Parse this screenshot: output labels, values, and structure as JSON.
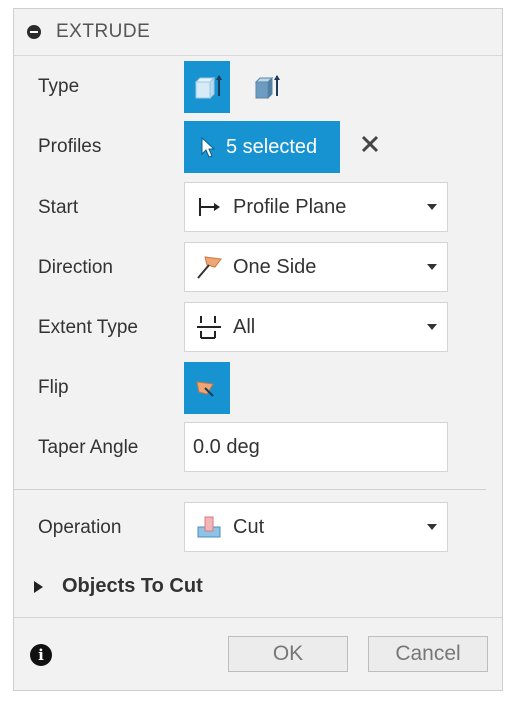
{
  "header": {
    "title": "EXTRUDE"
  },
  "rows": {
    "type": {
      "label": "Type"
    },
    "profiles": {
      "label": "Profiles",
      "selection": "5 selected"
    },
    "start": {
      "label": "Start",
      "value": "Profile Plane"
    },
    "direction": {
      "label": "Direction",
      "value": "One Side"
    },
    "extent_type": {
      "label": "Extent Type",
      "value": "All"
    },
    "flip": {
      "label": "Flip"
    },
    "taper_angle": {
      "label": "Taper Angle",
      "value": "0.0 deg"
    },
    "operation": {
      "label": "Operation",
      "value": "Cut"
    }
  },
  "section": {
    "label": "Objects To Cut"
  },
  "footer": {
    "ok_label": "OK",
    "cancel_label": "Cancel"
  },
  "colors": {
    "accent": "#1793d1",
    "panel": "#f2f2f2",
    "field_border": "#d4d4d4"
  }
}
